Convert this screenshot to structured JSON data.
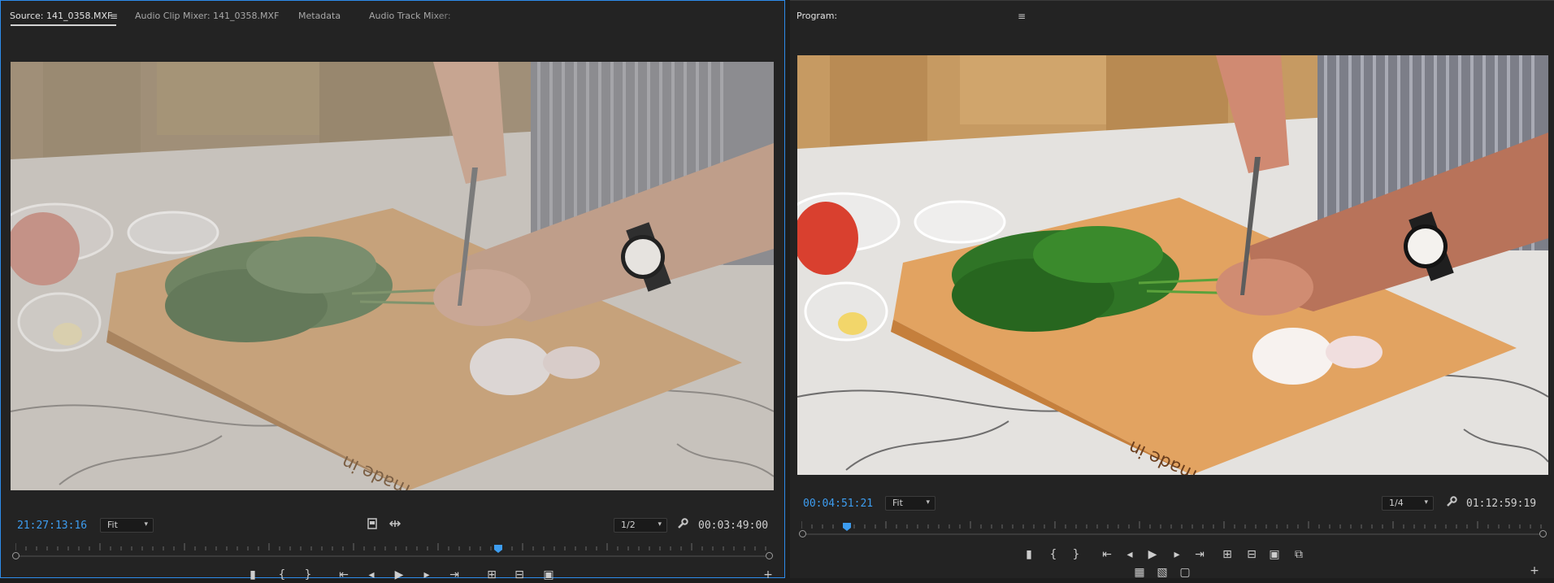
{
  "source": {
    "tabs": [
      {
        "label": "Source: 141_0358.MXF",
        "active": true
      },
      {
        "label": "Audio Clip Mixer: 141_0358.MXF",
        "active": false
      },
      {
        "label": "Metadata",
        "active": false
      },
      {
        "label": "Audio Track Mixer:",
        "active": false
      }
    ],
    "current_timecode": "21:27:13:16",
    "zoom": "Fit",
    "resolution": "1/2",
    "duration": "00:03:49:00",
    "playhead_fraction": 0.64,
    "wordmark": "made in",
    "grade": "flat-log"
  },
  "program": {
    "title": "Program:",
    "current_timecode": "00:04:51:21",
    "zoom": "Fit",
    "resolution": "1/4",
    "duration": "01:12:59:19",
    "playhead_fraction": 0.052,
    "wordmark": "made in",
    "grade": "color-corrected"
  },
  "icons": {
    "panel_menu": "≡",
    "wrench": "wrench-icon",
    "export_frame": "camera-icon"
  }
}
